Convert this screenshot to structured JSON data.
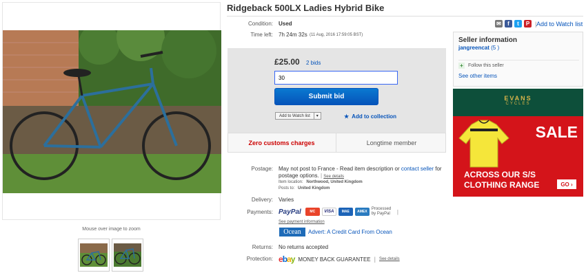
{
  "listing": {
    "title": "Ridgeback 500LX Ladies Hybrid Bike"
  },
  "gallery": {
    "zoom_hint": "Mouse over image to zoom"
  },
  "header": {
    "watch_list_link": "Add to Watch list",
    "separator": "|"
  },
  "details": {
    "condition_label": "Condition:",
    "condition_value": "Used",
    "time_left_label": "Time left:",
    "time_left_value": "7h 24m 32s",
    "end_time": "(11 Aug, 2016   17:59:05 BST)"
  },
  "bid": {
    "price": "£25.00",
    "bids_link": "2 bids",
    "input_value": "30",
    "submit_label": "Submit bid",
    "watch_select": "Add to Watch list",
    "collection_star": "★",
    "collection_link": "Add to collection"
  },
  "badges": {
    "customs": "Zero customs charges",
    "member": "Longtime member"
  },
  "shipping": {
    "postage_label": "Postage:",
    "postage_text_1": "May not post to France - Read item description or",
    "postage_contact": "contact seller",
    "postage_text_2": "for postage options.",
    "see_details": "See details",
    "item_location_label": "Item location:",
    "item_location_value": "Northwood, United Kingdom",
    "posts_to_label": "Posts to:",
    "posts_to_value": "United Kingdom",
    "delivery_label": "Delivery:",
    "delivery_value": "Varies",
    "payments_label": "Payments:",
    "paypal_logo": "PayPal",
    "processed_by": "Processed by PayPal",
    "see_payment": "See payment information",
    "ocean_logo": "Ocean",
    "ocean_ad": "Advert: A Credit Card From Ocean",
    "returns_label": "Returns:",
    "returns_value": "No returns accepted",
    "protection_label": "Protection:",
    "money_back": "MONEY BACK GUARANTEE",
    "protection_details": "See details"
  },
  "seller": {
    "heading": "Seller information",
    "name": "jangreencat",
    "feedback": "(5 )",
    "follow_icon_text": "+",
    "follow": "Follow this seller",
    "other_items": "See other items"
  },
  "ad": {
    "brand": "EVANS",
    "brand_sub": "CYCLES",
    "headline": "SALE",
    "line1": "ACROSS OUR S/S",
    "line2": "CLOTHING RANGE",
    "cta": "GO ›"
  },
  "payments": {
    "mastercard": "MC",
    "visa": "VISA",
    "maestro": "MAE",
    "amex": "AMEX"
  },
  "social": {
    "email": "✉",
    "facebook": "f",
    "twitter": "t",
    "pinterest": "P"
  },
  "colors": {
    "link": "#0654ba",
    "accent_red": "#cc0000",
    "ad_green": "#0d4f3a",
    "ad_red": "#d4141a"
  }
}
